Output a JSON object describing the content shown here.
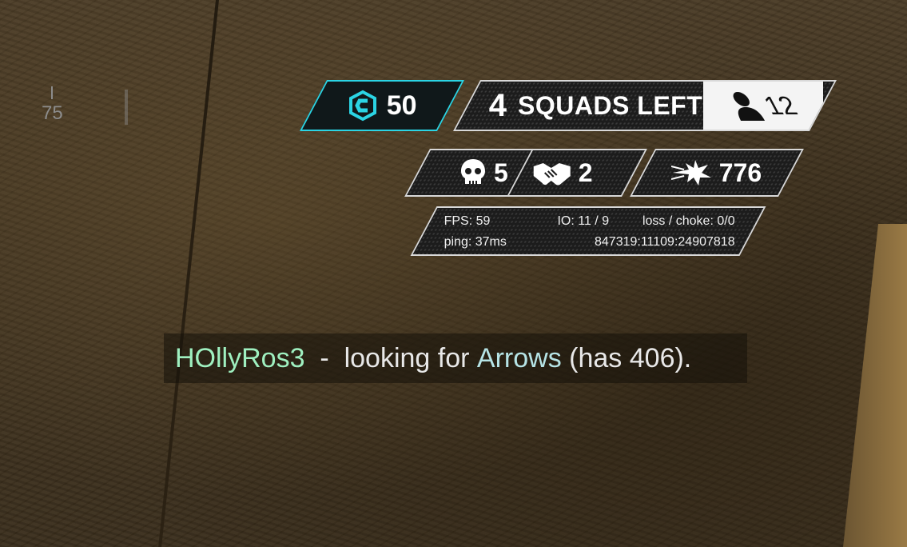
{
  "compass": {
    "heading": "75"
  },
  "hud": {
    "evo": {
      "icon": "evo-shield-icon",
      "value": "50",
      "color": "#2bd4e4"
    },
    "squads": {
      "count": "4",
      "label": "SQUADS LEFT"
    },
    "players": {
      "icon": "player-icon",
      "count": "12"
    },
    "kills": {
      "icon": "skull-icon",
      "value": "5"
    },
    "assists": {
      "icon": "handshake-icon",
      "value": "2"
    },
    "damage": {
      "icon": "damage-burst-icon",
      "value": "776"
    },
    "perf": {
      "fps": "FPS: 59",
      "io": "IO: 11 / 9",
      "loss": "loss / choke: 0/0",
      "ping": "ping: 37ms",
      "server": "847319:11109:24907818"
    }
  },
  "feed": {
    "player": "HOllyRos3",
    "dash": "  -  ",
    "text_before": "looking for ",
    "item": "Arrows",
    "text_after": " (has 406).",
    "player_color": "#9ff0c0",
    "item_color": "#b6e4e6"
  }
}
